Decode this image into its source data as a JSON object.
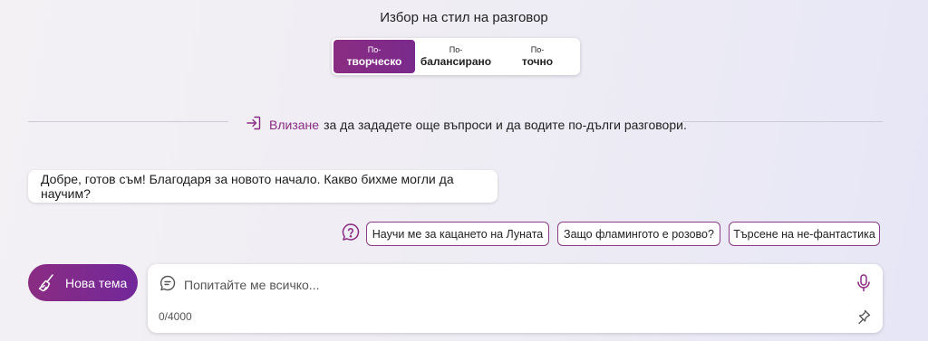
{
  "style_selector": {
    "title": "Избор на стил на разговор",
    "options": [
      {
        "pre": "По-",
        "main": "творческо",
        "active": true
      },
      {
        "pre": "По-",
        "main": "балансирано",
        "active": false
      },
      {
        "pre": "По-",
        "main": "точно",
        "active": false
      }
    ]
  },
  "signin": {
    "link": "Влизане",
    "text": "за да зададете още въпроси и да водите по-дълги разговори."
  },
  "bot_message": "Добре, готов съм! Благодаря за новото начало. Какво бихме могли да научим?",
  "suggestions": [
    "Научи ме за кацането на Луната",
    "Защо фламингото е розово?",
    "Търсене на не-фантастика"
  ],
  "new_topic_label": "Нова тема",
  "input": {
    "placeholder": "Попитайте ме всичко...",
    "char_count": "0/4000"
  },
  "colors": {
    "accent": "#8a2c82",
    "background": "#efedf4"
  },
  "icons": {
    "signin": "signin-arrow-icon",
    "help": "question-bubble-icon",
    "new_topic": "broom-icon",
    "chat": "chat-bubble-icon",
    "mic": "microphone-icon",
    "pin": "pin-icon"
  }
}
